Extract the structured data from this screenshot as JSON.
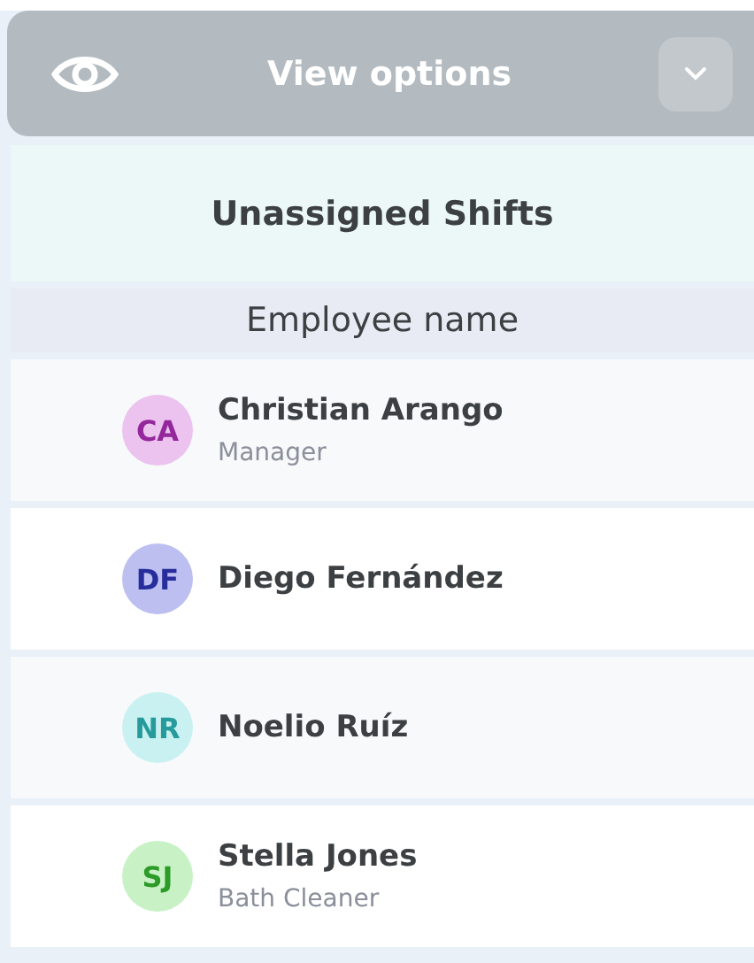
{
  "view_options": {
    "title": "View options"
  },
  "unassigned": {
    "label": "Unassigned Shifts"
  },
  "column_header": "Employee name",
  "employees": [
    {
      "initials": "CA",
      "name": "Christian Arango",
      "role": "Manager",
      "color": "#ecc3ef"
    },
    {
      "initials": "DF",
      "name": "Diego Fernández",
      "color": "#bcbff0"
    },
    {
      "initials": "NR",
      "name": "Noelio Ruíz",
      "color": "#c9f1f1"
    },
    {
      "initials": "SJ",
      "name": "Stella Jones",
      "role": "Bath Cleaner",
      "color": "#c8f2c6"
    }
  ]
}
